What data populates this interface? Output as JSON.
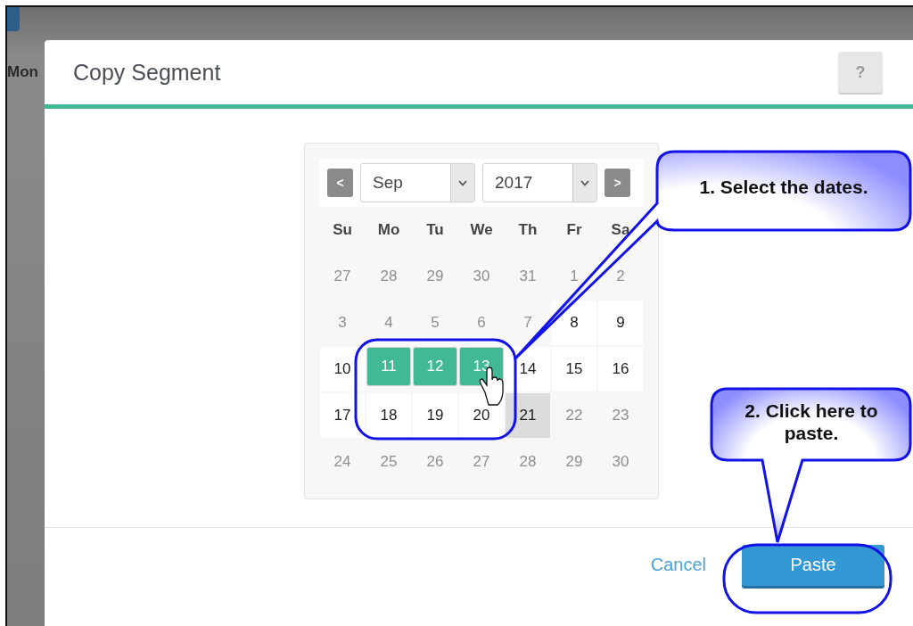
{
  "background": {
    "column_header": "Mon"
  },
  "dialog": {
    "title": "Copy Segment",
    "help_button": "?",
    "calendar": {
      "prev_button": "<",
      "month": "Sep",
      "year": "2017",
      "next_button": ">",
      "weekdays": [
        "Su",
        "Mo",
        "Tu",
        "We",
        "Th",
        "Fr",
        "Sa"
      ],
      "weeks": [
        [
          {
            "day": "27",
            "enabled": false,
            "selected": false,
            "today": false
          },
          {
            "day": "28",
            "enabled": false,
            "selected": false,
            "today": false
          },
          {
            "day": "29",
            "enabled": false,
            "selected": false,
            "today": false
          },
          {
            "day": "30",
            "enabled": false,
            "selected": false,
            "today": false
          },
          {
            "day": "31",
            "enabled": false,
            "selected": false,
            "today": false
          },
          {
            "day": "1",
            "enabled": false,
            "selected": false,
            "today": false
          },
          {
            "day": "2",
            "enabled": false,
            "selected": false,
            "today": false
          }
        ],
        [
          {
            "day": "3",
            "enabled": false,
            "selected": false,
            "today": false
          },
          {
            "day": "4",
            "enabled": false,
            "selected": false,
            "today": false
          },
          {
            "day": "5",
            "enabled": false,
            "selected": false,
            "today": false
          },
          {
            "day": "6",
            "enabled": false,
            "selected": false,
            "today": false
          },
          {
            "day": "7",
            "enabled": false,
            "selected": false,
            "today": false
          },
          {
            "day": "8",
            "enabled": true,
            "selected": false,
            "today": false
          },
          {
            "day": "9",
            "enabled": true,
            "selected": false,
            "today": false
          }
        ],
        [
          {
            "day": "10",
            "enabled": true,
            "selected": false,
            "today": false
          },
          {
            "day": "11",
            "enabled": true,
            "selected": true,
            "today": false
          },
          {
            "day": "12",
            "enabled": true,
            "selected": true,
            "today": false
          },
          {
            "day": "13",
            "enabled": true,
            "selected": true,
            "today": false
          },
          {
            "day": "14",
            "enabled": true,
            "selected": false,
            "today": false
          },
          {
            "day": "15",
            "enabled": true,
            "selected": false,
            "today": false
          },
          {
            "day": "16",
            "enabled": true,
            "selected": false,
            "today": false
          }
        ],
        [
          {
            "day": "17",
            "enabled": true,
            "selected": false,
            "today": false
          },
          {
            "day": "18",
            "enabled": true,
            "selected": false,
            "today": false
          },
          {
            "day": "19",
            "enabled": true,
            "selected": false,
            "today": false
          },
          {
            "day": "20",
            "enabled": true,
            "selected": false,
            "today": false
          },
          {
            "day": "21",
            "enabled": true,
            "selected": false,
            "today": true
          },
          {
            "day": "22",
            "enabled": false,
            "selected": false,
            "today": false
          },
          {
            "day": "23",
            "enabled": false,
            "selected": false,
            "today": false
          }
        ],
        [
          {
            "day": "24",
            "enabled": false,
            "selected": false,
            "today": false
          },
          {
            "day": "25",
            "enabled": false,
            "selected": false,
            "today": false
          },
          {
            "day": "26",
            "enabled": false,
            "selected": false,
            "today": false
          },
          {
            "day": "27",
            "enabled": false,
            "selected": false,
            "today": false
          },
          {
            "day": "28",
            "enabled": false,
            "selected": false,
            "today": false
          },
          {
            "day": "29",
            "enabled": false,
            "selected": false,
            "today": false
          },
          {
            "day": "30",
            "enabled": false,
            "selected": false,
            "today": false
          }
        ]
      ]
    },
    "cancel_link": "Cancel",
    "paste_button": "Paste"
  },
  "callouts": [
    {
      "text": "1. Select the dates."
    },
    {
      "text": "2. Click here to paste."
    }
  ]
}
